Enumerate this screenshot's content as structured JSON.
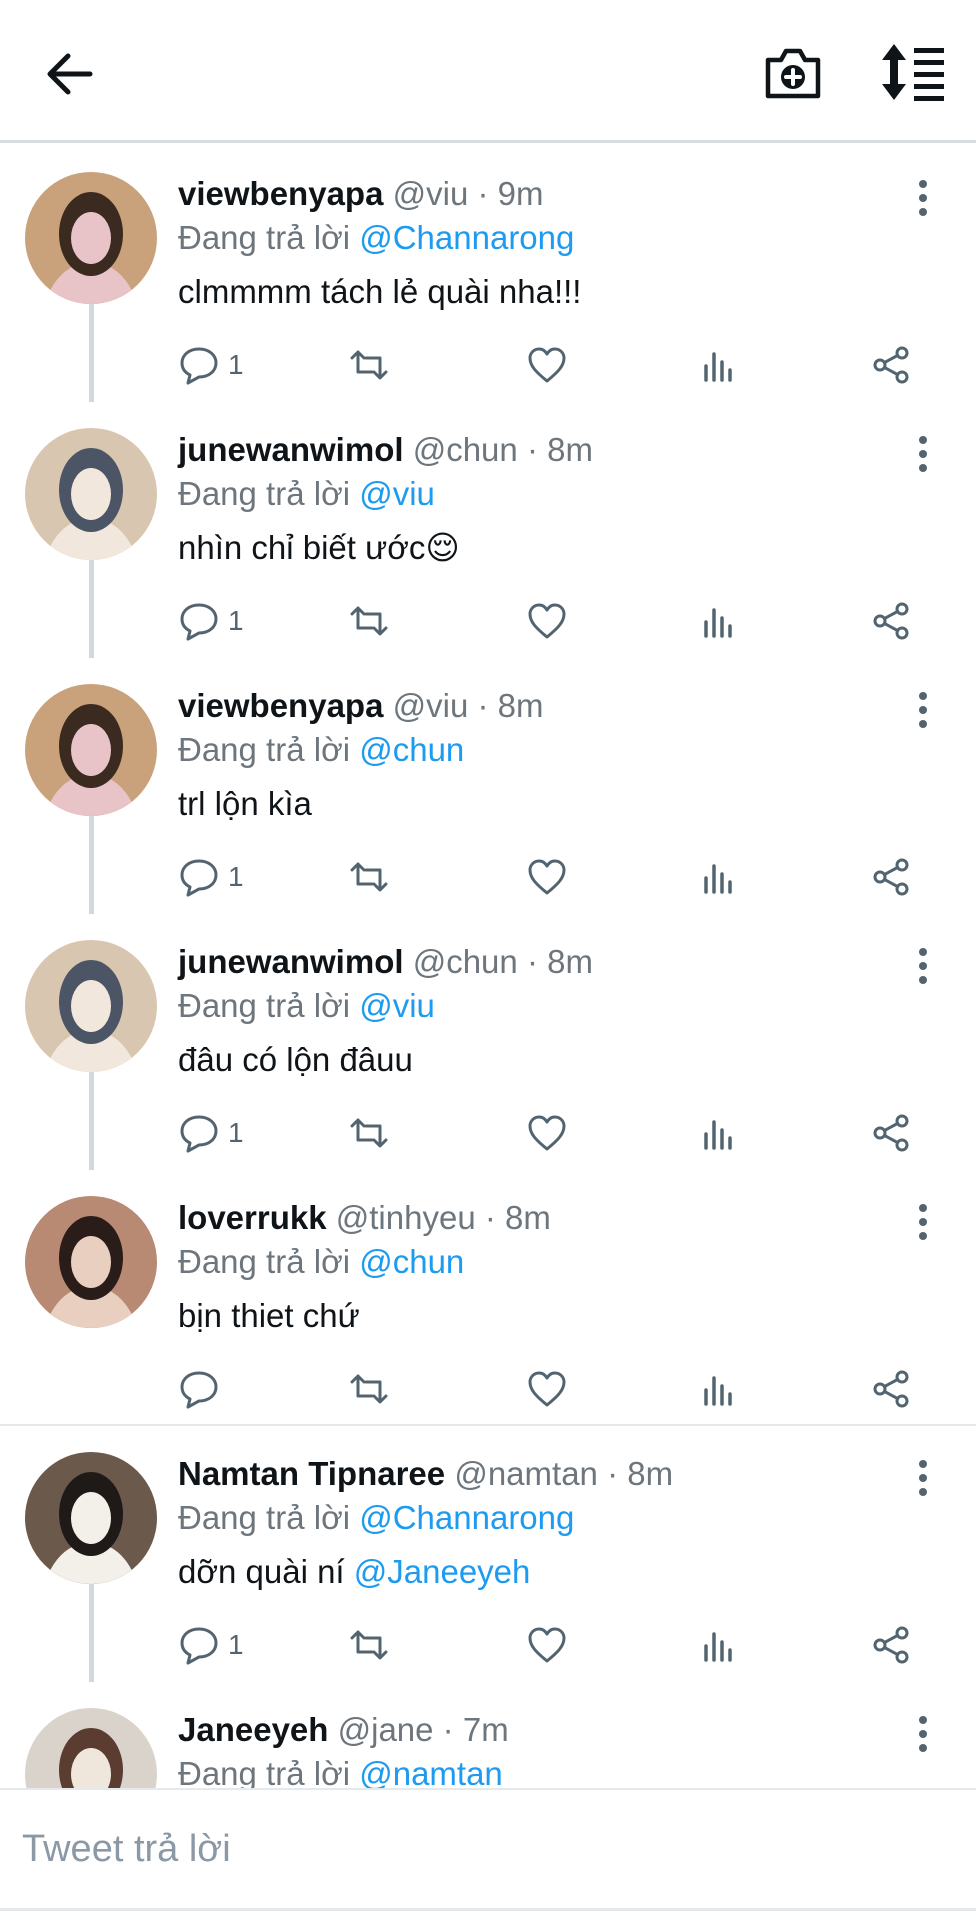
{
  "header": {
    "back_icon": "arrow-left-icon",
    "camera_icon": "camera-plus-icon",
    "sort_icon": "sort-list-icon"
  },
  "reply_prefix": "Đang trả lời",
  "tweets": [
    {
      "name": "viewbenyapa",
      "handle": "@viu",
      "dot": "·",
      "time": "9m",
      "reply_to": "@Channarong",
      "text": "clmmmm tách lẻ quài nha!!!",
      "mention": "",
      "reply_count": "1",
      "avatar_colors": [
        "#c9a27c",
        "#3a2a20",
        "#e8c3c8"
      ]
    },
    {
      "name": "junewanwimol",
      "handle": "@chun",
      "dot": "·",
      "time": "8m",
      "reply_to": "@viu",
      "text": "nhìn chỉ biết ước😌",
      "mention": "",
      "reply_count": "1",
      "avatar_colors": [
        "#d8c6b0",
        "#4b5566",
        "#f1e7dc"
      ]
    },
    {
      "name": "viewbenyapa",
      "handle": "@viu",
      "dot": "·",
      "time": "8m",
      "reply_to": "@chun",
      "text": "trl lộn kìa",
      "mention": "",
      "reply_count": "1",
      "avatar_colors": [
        "#c9a27c",
        "#3a2a20",
        "#e8c3c8"
      ]
    },
    {
      "name": "junewanwimol",
      "handle": "@chun",
      "dot": "·",
      "time": "8m",
      "reply_to": "@viu",
      "text": "đâu có lộn đâuu",
      "mention": "",
      "reply_count": "1",
      "avatar_colors": [
        "#d8c6b0",
        "#4b5566",
        "#f1e7dc"
      ]
    },
    {
      "name": "loverrukk",
      "handle": "@tinhyeu",
      "dot": "·",
      "time": "8m",
      "reply_to": "@chun",
      "text": "bịn thiet chứ",
      "mention": "",
      "reply_count": "",
      "avatar_colors": [
        "#b88a74",
        "#2a1c18",
        "#e9cfc0"
      ]
    },
    {
      "name": "Namtan Tipnaree",
      "handle": "@namtan",
      "dot": "·",
      "time": "8m",
      "reply_to": "@Channarong",
      "text": "dỡn quài ní ",
      "mention": "@Janeeyeh",
      "reply_count": "1",
      "avatar_colors": [
        "#6b5a4c",
        "#1f1a18",
        "#f3efe9"
      ]
    },
    {
      "name": "Janeeyeh",
      "handle": "@jane",
      "dot": "·",
      "time": "7m",
      "reply_to": "@namtan",
      "text": "",
      "mention": "",
      "reply_count": "",
      "avatar_colors": [
        "#d9d3cc",
        "#5a3d30",
        "#efe6dc"
      ]
    }
  ],
  "composer": {
    "placeholder": "Tweet trả lời",
    "value": ""
  }
}
